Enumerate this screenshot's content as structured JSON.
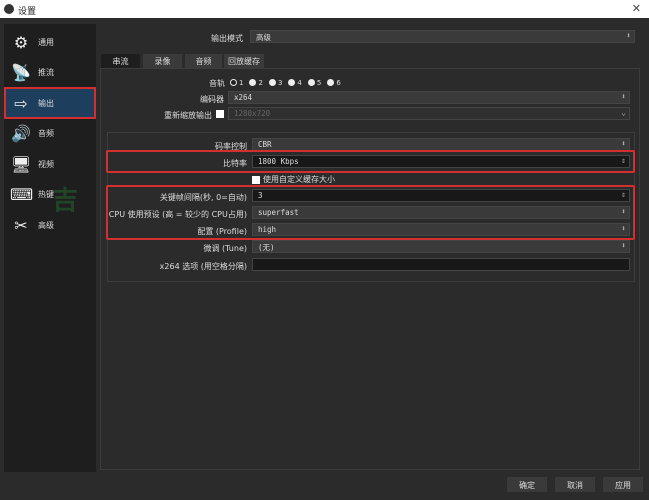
{
  "window": {
    "title": "设置",
    "close": "✕"
  },
  "sidebar": {
    "items": [
      {
        "label": "通用",
        "icon": "gear-icon",
        "glyph": "⚙"
      },
      {
        "label": "推流",
        "icon": "broadcast-icon",
        "glyph": "📡"
      },
      {
        "label": "输出",
        "icon": "output-monitor-icon",
        "glyph": "⇨",
        "selected": true
      },
      {
        "label": "音频",
        "icon": "speaker-icon",
        "glyph": "🔊"
      },
      {
        "label": "视频",
        "icon": "monitor-icon",
        "glyph": "🖥"
      },
      {
        "label": "热键",
        "icon": "keyboard-icon",
        "glyph": "⌨"
      },
      {
        "label": "高级",
        "icon": "tools-icon",
        "glyph": "✂"
      }
    ]
  },
  "output_mode": {
    "label": "输出模式",
    "value": "高级"
  },
  "tabs": [
    "串流",
    "录像",
    "音频",
    "回放缓存"
  ],
  "audio_track": {
    "label": "音轨",
    "tracks": [
      "1",
      "2",
      "3",
      "4",
      "5",
      "6"
    ],
    "selected": "1"
  },
  "encoder": {
    "label": "编码器",
    "value": "x264"
  },
  "rescale": {
    "label": "重新缩放输出",
    "value": "1280x720",
    "checked": false
  },
  "rate_control": {
    "label": "码率控制",
    "value": "CBR"
  },
  "bitrate": {
    "label": "比特率",
    "value": "1800 Kbps"
  },
  "custom_buffer": {
    "label": "使用自定义缓存大小",
    "checked": false
  },
  "keyframe": {
    "label": "关键帧间隔(秒, 0=自动)",
    "value": "3"
  },
  "cpu_preset": {
    "label": "CPU 使用预设 (高 = 较少的 CPU占用)",
    "value": "superfast"
  },
  "profile": {
    "label": "配置 (Profile)",
    "value": "high"
  },
  "tune": {
    "label": "微调 (Tune)",
    "value": "(无)"
  },
  "x264_opts": {
    "label": "x264 选项 (用空格分隔)",
    "value": ""
  },
  "buttons": {
    "ok": "确定",
    "cancel": "取消",
    "apply": "应用"
  },
  "watermark": "吉",
  "colors": {
    "highlight": "#d32f2f",
    "selected_bg": "#1d3e5c"
  }
}
